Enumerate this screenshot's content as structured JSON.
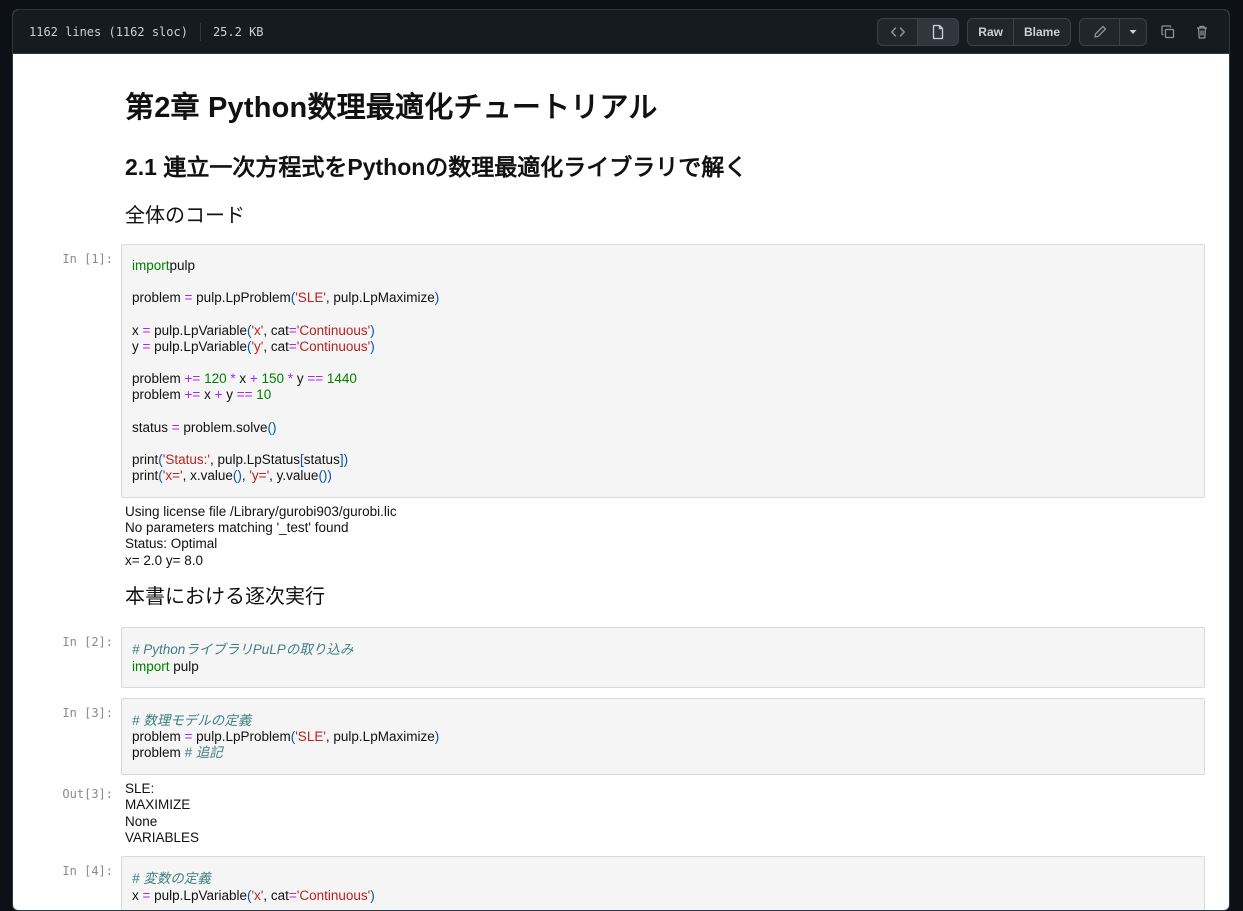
{
  "file": {
    "lines": "1162 lines (1162 sloc)",
    "size": "25.2 KB"
  },
  "toolbar": {
    "raw_label": "Raw",
    "blame_label": "Blame"
  },
  "icons": [
    "code-icon",
    "file-icon",
    "pencil-icon",
    "triangle-down-icon",
    "copy-icon",
    "trash-icon"
  ],
  "notebook": {
    "title": "第2章 Python数理最適化チュートリアル",
    "subtitle": "2.1 連立一次方程式をPythonの数理最適化ライブラリで解く",
    "section1": "全体のコード",
    "section2": "本書における逐次実行",
    "cells": {
      "in1": {
        "prompt": "In [1]:",
        "lines": [
          [
            [
              "kw",
              "import"
            ],
            [
              "",
              "pulp"
            ]
          ],
          [],
          [
            [
              "",
              "problem "
            ],
            [
              "op",
              "="
            ],
            [
              "",
              " pulp.LpProblem"
            ],
            [
              "par",
              "("
            ],
            [
              "str",
              "'SLE'"
            ],
            [
              "",
              ", pulp.LpMaximize"
            ],
            [
              "par",
              ")"
            ]
          ],
          [],
          [
            [
              "",
              "x "
            ],
            [
              "op",
              "="
            ],
            [
              "",
              " pulp.LpVariable"
            ],
            [
              "par",
              "("
            ],
            [
              "str",
              "'x'"
            ],
            [
              "",
              ", cat"
            ],
            [
              "op",
              "="
            ],
            [
              "str",
              "'Continuous'"
            ],
            [
              "par",
              ")"
            ]
          ],
          [
            [
              "",
              "y "
            ],
            [
              "op",
              "="
            ],
            [
              "",
              " pulp.LpVariable"
            ],
            [
              "par",
              "("
            ],
            [
              "str",
              "'y'"
            ],
            [
              "",
              ", cat"
            ],
            [
              "op",
              "="
            ],
            [
              "str",
              "'Continuous'"
            ],
            [
              "par",
              ")"
            ]
          ],
          [],
          [
            [
              "",
              "problem "
            ],
            [
              "op",
              "+="
            ],
            [
              "num",
              " 120 "
            ],
            [
              "op",
              "*"
            ],
            [
              "",
              " x "
            ],
            [
              "op",
              "+"
            ],
            [
              "num",
              " 150 "
            ],
            [
              "op",
              "*"
            ],
            [
              "",
              " y "
            ],
            [
              "op",
              "=="
            ],
            [
              "num",
              " 1440"
            ]
          ],
          [
            [
              "",
              "problem "
            ],
            [
              "op",
              "+="
            ],
            [
              "",
              " x "
            ],
            [
              "op",
              "+"
            ],
            [
              "",
              " y "
            ],
            [
              "op",
              "=="
            ],
            [
              "num",
              " 10"
            ]
          ],
          [],
          [
            [
              "",
              "status "
            ],
            [
              "op",
              "="
            ],
            [
              "",
              " problem.solve"
            ],
            [
              "par",
              "()"
            ]
          ],
          [],
          [
            [
              "",
              "print"
            ],
            [
              "par",
              "("
            ],
            [
              "str",
              "'Status:'"
            ],
            [
              "",
              ", pulp.LpStatus"
            ],
            [
              "par",
              "["
            ],
            [
              "",
              "status"
            ],
            [
              "par",
              "])"
            ]
          ],
          [
            [
              "",
              "print"
            ],
            [
              "par",
              "("
            ],
            [
              "str",
              "'x='"
            ],
            [
              "",
              ", x.value"
            ],
            [
              "par",
              "()"
            ],
            [
              "",
              ", "
            ],
            [
              "str",
              "'y='"
            ],
            [
              "",
              ", y.value"
            ],
            [
              "par",
              "())"
            ]
          ]
        ],
        "output": [
          "Using license file /Library/gurobi903/gurobi.lic",
          "No parameters matching '_test' found",
          "Status: Optimal",
          "x= 2.0 y= 8.0"
        ]
      },
      "in2": {
        "prompt": "In [2]:",
        "lines": [
          [
            [
              "cm",
              "# PythonライブラリPuLPの取り込み"
            ]
          ],
          [
            [
              "kw",
              "import"
            ],
            [
              "",
              " pulp"
            ]
          ]
        ]
      },
      "in3": {
        "prompt": "In [3]:",
        "lines": [
          [
            [
              "cm",
              "# 数理モデルの定義"
            ]
          ],
          [
            [
              "",
              "problem "
            ],
            [
              "op",
              "="
            ],
            [
              "",
              " pulp.LpProblem"
            ],
            [
              "par",
              "("
            ],
            [
              "str",
              "'SLE'"
            ],
            [
              "",
              ", pulp.LpMaximize"
            ],
            [
              "par",
              ")"
            ]
          ],
          [
            [
              "",
              "problem "
            ],
            [
              "cm",
              "# 追記"
            ]
          ]
        ],
        "out_prompt": "Out[3]:",
        "output": [
          "SLE:",
          "MAXIMIZE",
          "None",
          "VARIABLES"
        ]
      },
      "in4": {
        "prompt": "In [4]:",
        "lines": [
          [
            [
              "cm",
              "# 変数の定義"
            ]
          ],
          [
            [
              "",
              "x "
            ],
            [
              "op",
              "="
            ],
            [
              "",
              " pulp.LpVariable"
            ],
            [
              "par",
              "("
            ],
            [
              "str",
              "'x'"
            ],
            [
              "",
              ", cat"
            ],
            [
              "op",
              "="
            ],
            [
              "str",
              "'Continuous'"
            ],
            [
              "par",
              ")"
            ]
          ]
        ]
      }
    }
  }
}
